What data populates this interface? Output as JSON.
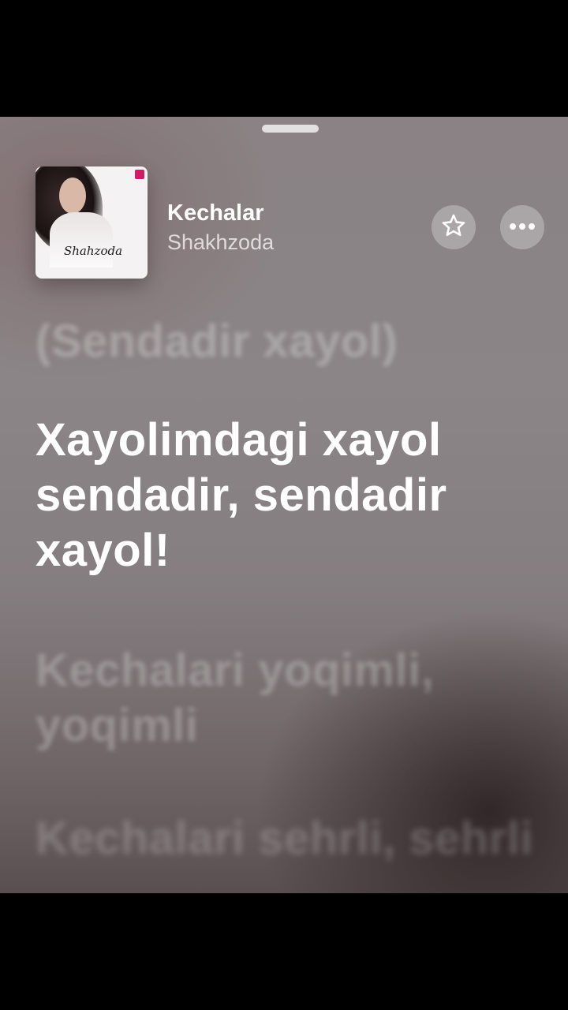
{
  "now_playing": {
    "title": "Kechalar",
    "artist": "Shakhzoda",
    "artwork": {
      "signature_text": "Shahzoda"
    },
    "actions": {
      "favorite_icon": "star-icon",
      "more_icon": "ellipsis-icon"
    }
  },
  "lyrics": {
    "previous_line": "(Sendadir xayol)",
    "current_line": "Xayolimdagi xayol sendadir, sendadir xayol!",
    "next_lines": [
      "Kechalari yoqimli, yoqimli",
      "Kechalari sehrli, sehrli"
    ]
  },
  "colors": {
    "background_top": "#8a8284",
    "background_bottom": "#5a4f50",
    "active_lyric": "#ffffff",
    "accent_badge": "#d01b68"
  }
}
